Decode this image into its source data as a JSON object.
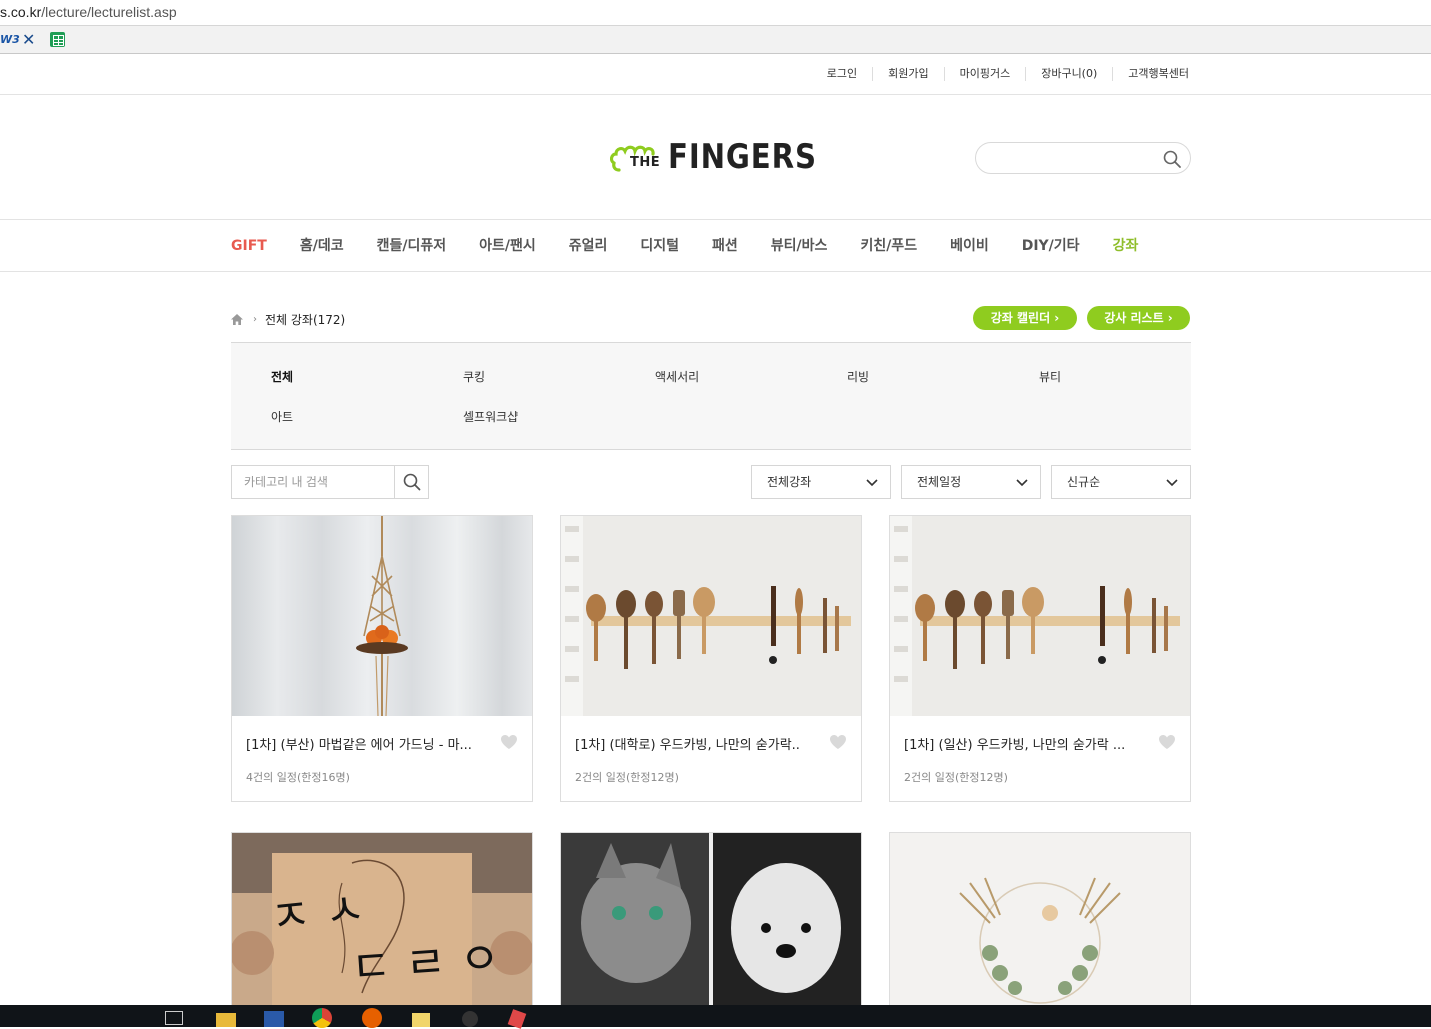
{
  "browser": {
    "url_host": "s.co.kr",
    "url_path": "/lecture/lecturelist.asp",
    "bookmarks": [
      {
        "label": "W3",
        "icon": "w3schools-icon"
      },
      {
        "label": "",
        "icon": "bookmark-x-icon"
      },
      {
        "label": "",
        "icon": "spreadsheet-icon"
      }
    ]
  },
  "util_nav": [
    "로그인",
    "회원가입",
    "마이핑거스",
    "장바구니(0)",
    "고객행복센터"
  ],
  "logo": {
    "small": "THE",
    "big": "FINGERS"
  },
  "search": {
    "placeholder": "",
    "value": ""
  },
  "gnb": [
    "GIFT",
    "홈/데코",
    "캔들/디퓨저",
    "아트/팬시",
    "쥬얼리",
    "디지털",
    "패션",
    "뷰티/바스",
    "키친/푸드",
    "베이비",
    "DIY/기타",
    "강좌"
  ],
  "breadcrumb": {
    "current": "전체 강좌(172)"
  },
  "buttons": {
    "calendar": "강좌 캘린더 ›",
    "instructors": "강사 리스트 ›"
  },
  "categories": [
    "전체",
    "쿠킹",
    "액세서리",
    "리빙",
    "뷰티",
    "아트",
    "셀프워크샵"
  ],
  "filters": {
    "search_placeholder": "카테고리 내 검색",
    "type": "전체강좌",
    "schedule": "전체일정",
    "sort": "신규순"
  },
  "cards": [
    {
      "title": "[1차] (부산) 마법같은 에어 가드닝 - 마...",
      "sub": "4건의 일정(한정16명)"
    },
    {
      "title": "[1차] (대학로) 우드카빙, 나만의 숟가락..",
      "sub": "2건의 일정(한정12명)"
    },
    {
      "title": "[1차] (일산) 우드카빙, 나만의 숟가락 ...",
      "sub": "2건의 일정(한정12명)"
    }
  ],
  "colors": {
    "accent_green": "#8fcc1f",
    "gift_red": "#e85a4f",
    "active_nav": "#8fbe2b"
  }
}
